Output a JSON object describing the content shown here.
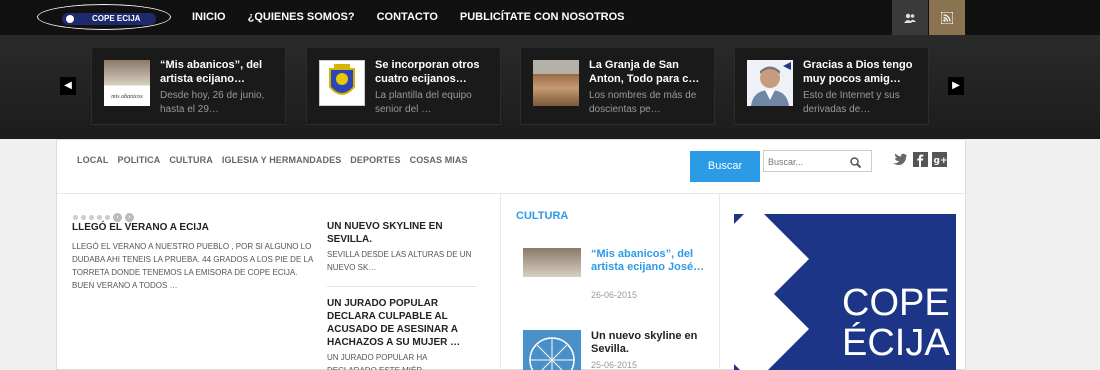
{
  "logo": {
    "text": "COPE ECIJA"
  },
  "nav": {
    "items": [
      "INICIO",
      "¿QUIENES SOMOS?",
      "CONTACTO",
      "PUBLICÍTATE CON NOSOTROS"
    ]
  },
  "slider": {
    "cards": [
      {
        "title": "“Mis abanicos”, del artista ecijano…",
        "desc": "Desde hoy, 26 de junio, hasta el 29…"
      },
      {
        "title": "Se incorporan otros cuatro ecijanos…",
        "desc": "La plantilla del equipo senior del …"
      },
      {
        "title": "La Granja de San Anton, Todo para c…",
        "desc": "Los nombres de más de doscientas pe…"
      },
      {
        "title": "Gracias a Dios tengo muy pocos amig…",
        "desc": "Esto de Internet y sus derivadas de…"
      }
    ],
    "thumb1_caption": "mis abanicos"
  },
  "categories": [
    "LOCAL",
    "POLITICA",
    "CULTURA",
    "IGLESIA Y HERMANDADES",
    "DEPORTES",
    "COSAS MIAS"
  ],
  "search": {
    "button_label": "Buscar",
    "placeholder": "Buscar..."
  },
  "main_story": {
    "title": "LLEGÓ EL VERANO A ECIJA",
    "text": "LLEGÓ EL VERANO A NUESTRO PUEBLO , POR SI ALGUNO LO DUDABA AHI TENEIS LA PRUEBA. 44 GRADOS A LOS PIE DE LA TORRETA DONDE TENEMOS LA EMISORA DE COPE ECIJA. BUEN VERANO A TODOS …"
  },
  "side_stories": [
    {
      "title": "UN NUEVO SKYLINE EN SEVILLA.",
      "text": "SEVILLA DESDE LAS ALTURAS DE UN NUEVO SK…"
    },
    {
      "title": "UN JURADO POPULAR DECLARA CULPABLE AL ACUSADO DE ASESINAR A HACHAZOS A SU MUJER …",
      "text": "UN JURADO POPULAR HA DECLARADO ESTE MIÉR"
    }
  ],
  "cultura": {
    "heading": "CULTURA",
    "items": [
      {
        "title": "“Mis abanicos”, del artista ecijano José…",
        "date": "26-06-2015",
        "color": "#2c9be6"
      },
      {
        "title": "Un nuevo skyline en Sevilla.",
        "date": "25-06-2015",
        "color": "#222222"
      }
    ]
  },
  "ad": {
    "line1": "COPE",
    "line2": "ÉCIJA"
  }
}
